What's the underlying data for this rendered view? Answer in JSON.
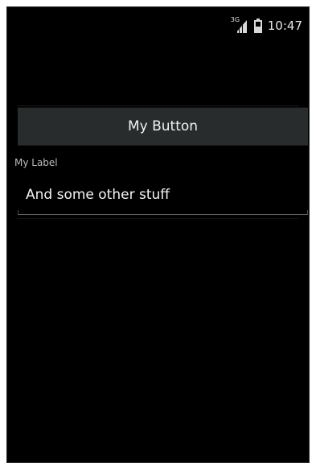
{
  "status_bar": {
    "network_tag": "3G",
    "time": "10:47",
    "signal_icon": "signal-icon",
    "battery_icon": "battery-icon"
  },
  "main": {
    "button_label": "My Button",
    "label_text": "My Label",
    "text_field_value": "And some other stuff"
  },
  "colors": {
    "background": "#000000",
    "button_bg": "#282c2d",
    "text_primary": "#f2f2f2",
    "label_text": "#bdbdbd"
  }
}
